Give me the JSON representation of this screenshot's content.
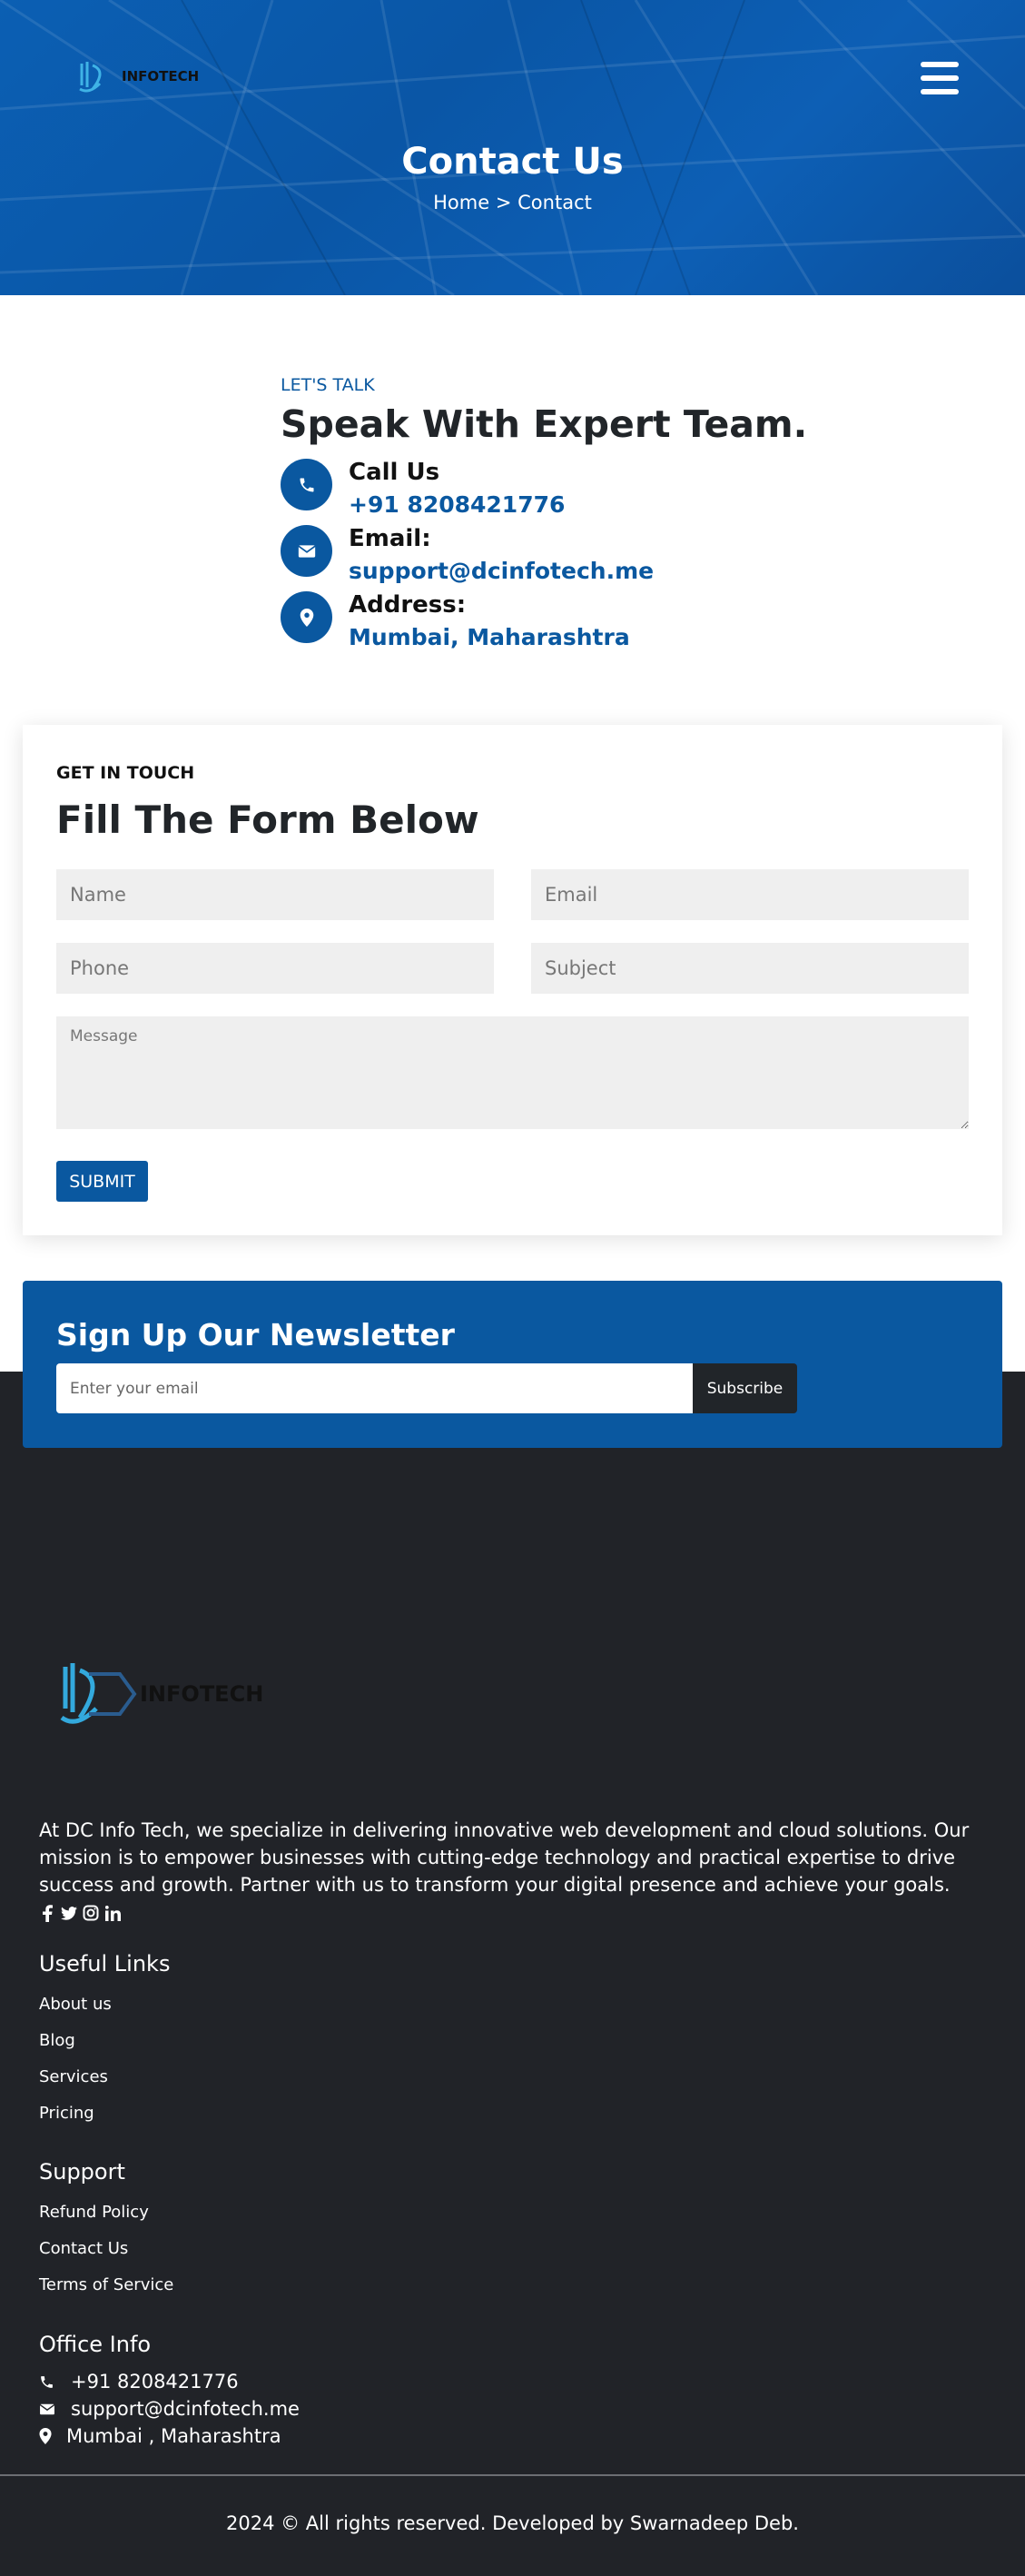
{
  "header": {
    "logo_text": "INFOTECH",
    "title": "Contact Us",
    "breadcrumb": {
      "home": "Home",
      "separator": ">",
      "current": "Contact"
    }
  },
  "contact": {
    "eyebrow": "LET'S TALK",
    "heading": "Speak With Expert Team.",
    "items": [
      {
        "label": "Call Us",
        "value": "+91 8208421776",
        "icon": "phone-icon"
      },
      {
        "label": "Email:",
        "value": "support@dcinfotech.me",
        "icon": "envelope-icon"
      },
      {
        "label": "Address:",
        "value": "Mumbai, Maharashtra",
        "icon": "map-pin-icon"
      }
    ]
  },
  "form": {
    "eyebrow": "GET IN TOUCH",
    "heading": "Fill The Form Below",
    "name_placeholder": "Name",
    "email_placeholder": "Email",
    "phone_placeholder": "Phone",
    "subject_placeholder": "Subject",
    "message_placeholder": "Message",
    "submit_label": "SUBMIT"
  },
  "newsletter": {
    "heading": "Sign Up Our Newsletter",
    "email_placeholder": "Enter your email",
    "button_label": "Subscribe"
  },
  "footer": {
    "logo_text": "INFOTECH",
    "about": "At DC Info Tech, we specialize in delivering innovative web development and cloud solutions. Our mission is to empower businesses with cutting-edge technology and practical expertise to drive success and growth. Partner with us to transform your digital presence and achieve your goals.",
    "socials": [
      "facebook-icon",
      "twitter-icon",
      "instagram-icon",
      "linkedin-icon"
    ],
    "useful_links": {
      "heading": "Useful Links",
      "items": [
        "About us",
        "Blog",
        "Services",
        "Pricing"
      ]
    },
    "support": {
      "heading": "Support",
      "items": [
        "Refund Policy",
        "Contact Us",
        "Terms of Service"
      ]
    },
    "office": {
      "heading": "Office Info",
      "phone": "+91 8208421776",
      "email": "support@dcinfotech.me",
      "address": "Mumbai , Maharashtra"
    },
    "copyright": "2024 © All rights reserved. Developed by Swarnadeep Deb."
  },
  "colors": {
    "brand_blue": "#0a58a0",
    "footer_bg": "#212328"
  }
}
